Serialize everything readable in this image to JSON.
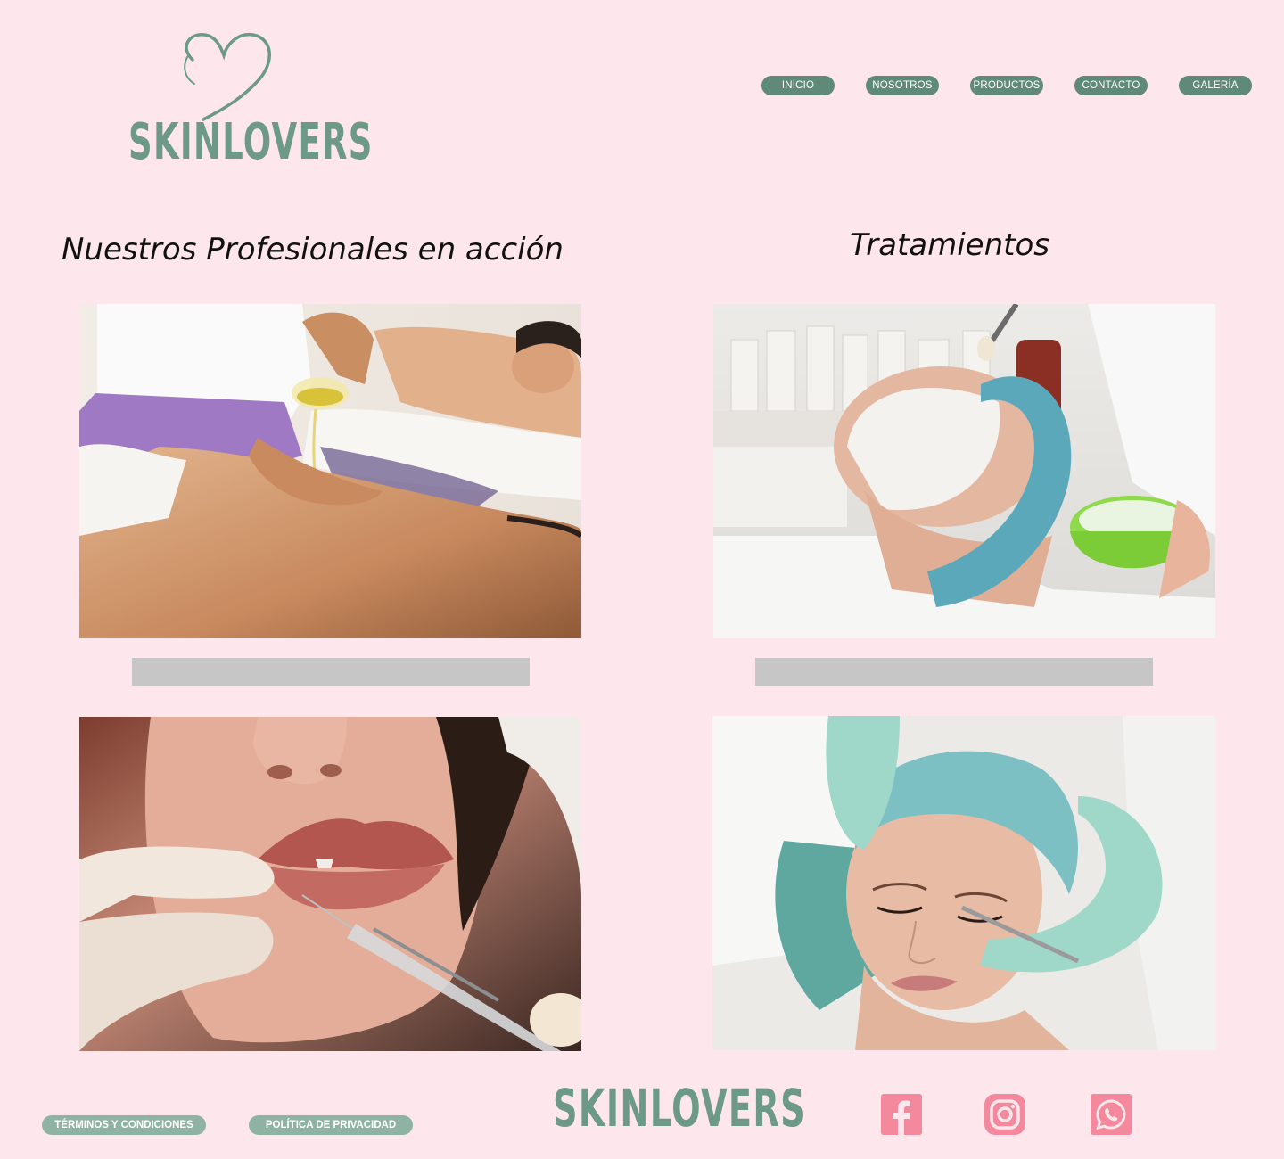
{
  "brand": {
    "name": "SKINLOVERS"
  },
  "nav": {
    "items": [
      {
        "label": "INICIO"
      },
      {
        "label": "NOSOTROS"
      },
      {
        "label": "PRODUCTOS"
      },
      {
        "label": "CONTACTO"
      },
      {
        "label": "GALERÍA"
      }
    ]
  },
  "sections": {
    "left_title": "Nuestros Profesionales en acción",
    "right_title": "Tratamientos"
  },
  "footer": {
    "terms_label": "TÉRMINOS Y CONDICIONES",
    "privacy_label": "POLÍTICA DE PRIVACIDAD",
    "brand": "SKINLOVERS",
    "social_icons": [
      "facebook-icon",
      "instagram-icon",
      "whatsapp-icon"
    ]
  },
  "colors": {
    "background": "#fde6ec",
    "brand_green": "#6c9a86",
    "nav_green": "#5f8a77",
    "footer_pill": "#8fb3a2",
    "social_pink": "#f4889c",
    "placeholder_gray": "#c6c6c6"
  }
}
